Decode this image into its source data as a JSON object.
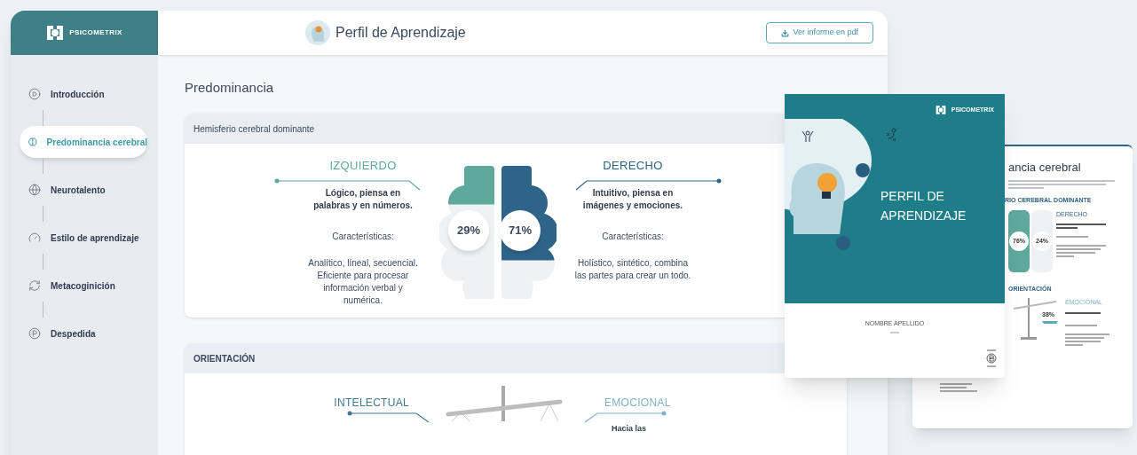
{
  "app": {
    "logo": "PSICOMETRIX",
    "title": "Perfil de Aprendizaje",
    "pdf_button": "Ver informe en pdf"
  },
  "sidebar": {
    "items": [
      {
        "label": "Introducción",
        "kind": "play",
        "selected": false
      },
      {
        "label": "Predominancia cerebral",
        "kind": "brain",
        "selected": true
      },
      {
        "label": "Neurotalento",
        "kind": "globe",
        "selected": false
      },
      {
        "label": "Estilo de aprendizaje",
        "kind": "gauge",
        "selected": false
      },
      {
        "label": "Metacoginición",
        "kind": "cycle",
        "selected": false
      },
      {
        "label": "Despedida",
        "kind": "farewell",
        "selected": false
      }
    ]
  },
  "page_title": "Predominancia",
  "hemisphere": {
    "title": "Hemisferio cerebral dominante",
    "sides": [
      {
        "heading": "IZQUIERDO",
        "summary": "Lógico, piensa en palabras y en números.",
        "characteristics_label": "Características:",
        "description": "Analítico, líneal, secuencial. Eficiente para procesar información verbal y numérica.",
        "percent": "29%",
        "level": 0.29,
        "color": "#5fa89c"
      },
      {
        "heading": "DERECHO",
        "summary": "Intuitivo, piensa en imágenes y emociones.",
        "characteristics_label": "Características:",
        "description": "Holístico, sintético, combina las partes para crear un todo.",
        "percent": "71%",
        "level": 0.71,
        "color": "#2f6489"
      }
    ]
  },
  "orientation": {
    "title": "ORIENTACIÓN",
    "left_heading": "INTELECTUAL",
    "right_heading": "EMOCIONAL",
    "right_summary": "Hacia las"
  },
  "report_cover": {
    "logo": "PSICOMETRIX",
    "title": "PERFIL DE APRENDIZAJE",
    "name": "NOMBRE APELLIDO"
  },
  "report_page": {
    "title": "ancia cerebral",
    "section": "RIO CEREBRAL DOMINANTE",
    "percents": [
      "76%",
      "24%"
    ],
    "side_heading": "DERECHO",
    "orientation": "ORIENTACIÓN",
    "orientation_heading": "EMOCIONAL",
    "orientation_percent": "38%"
  }
}
